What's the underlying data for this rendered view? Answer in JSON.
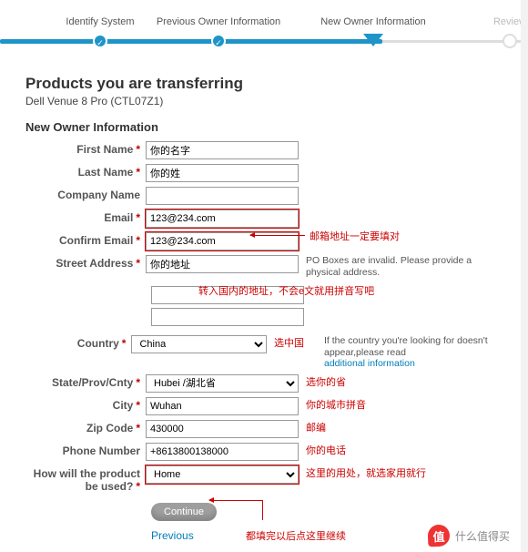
{
  "steps": {
    "s1": "Identify System",
    "s2": "Previous Owner Information",
    "s3": "New Owner Information",
    "s4": "Review"
  },
  "heading": "Products you are transferring",
  "subheading": "Dell Venue 8 Pro (CTL07Z1)",
  "section": "New Owner Information",
  "labels": {
    "first_name": "First Name",
    "last_name": "Last Name",
    "company": "Company Name",
    "email": "Email",
    "confirm_email": "Confirm Email",
    "street": "Street Address",
    "country": "Country",
    "state": "State/Prov/Cnty",
    "city": "City",
    "zip": "Zip Code",
    "phone": "Phone Number",
    "usage": "How will the product be used?"
  },
  "values": {
    "first_name": "你的名字",
    "last_name": "你的姓",
    "company": "",
    "email": "123@234.com",
    "confirm_email": "123@234.com",
    "street": "你的地址",
    "country": "China",
    "state": "Hubei /湖北省",
    "city": "Wuhan",
    "zip": "430000",
    "phone": "+8613800138000",
    "usage": "Home"
  },
  "notes": {
    "po": "PO Boxes are invalid. Please provide a physical address.",
    "country_hint": "If the country you're looking for doesn't appear,please read",
    "additional": "additional information"
  },
  "buttons": {
    "continue": "Continue",
    "previous": "Previous"
  },
  "annotations": {
    "email": "邮箱地址一定要填对",
    "street": "转入国内的地址，不会e文就用拼音写吧",
    "country": "选中国",
    "state": "选你的省",
    "city": "你的城市拼音",
    "zip": "邮编",
    "phone": "你的电话",
    "usage": "这里的用处，就选家用就行",
    "continue": "都填完以后点这里继续"
  },
  "watermark": "什么值得买"
}
